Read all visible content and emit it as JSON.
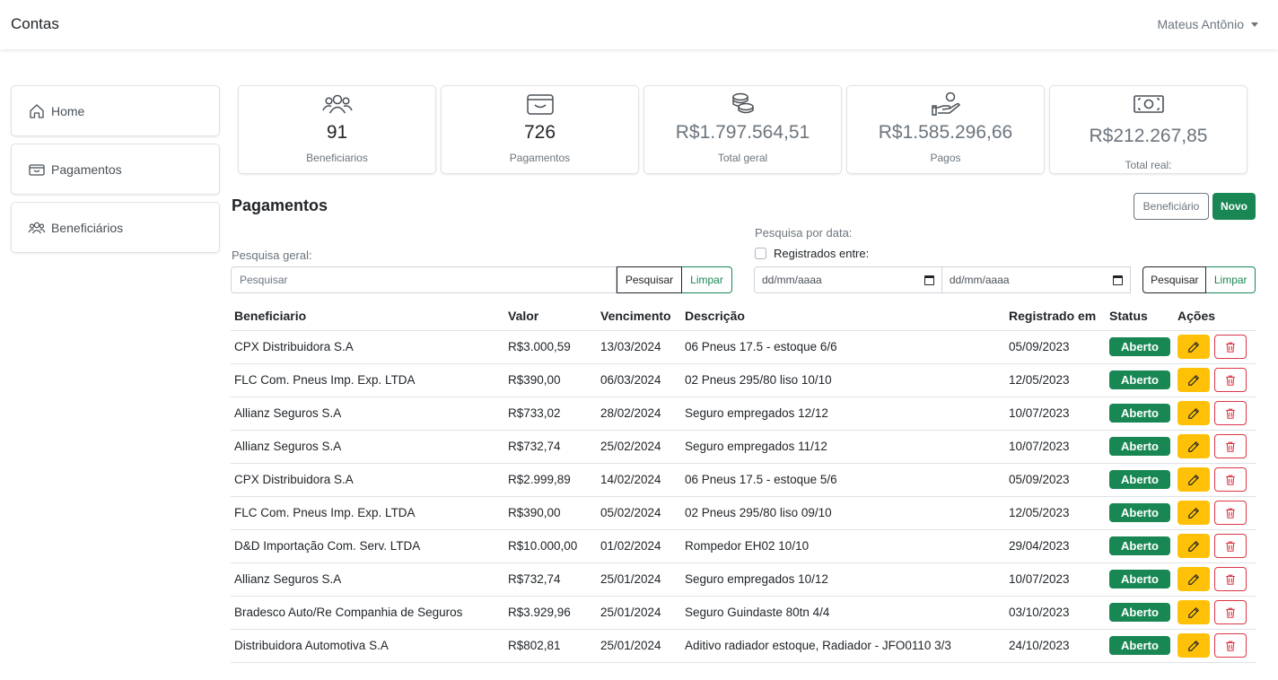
{
  "app": {
    "title": "Contas",
    "user": "Mateus Antônio"
  },
  "sidebar": {
    "items": [
      {
        "label": "Home",
        "icon": "home-icon"
      },
      {
        "label": "Pagamentos",
        "icon": "wallet-icon"
      },
      {
        "label": "Beneficiários",
        "icon": "people-icon"
      }
    ]
  },
  "cards": [
    {
      "value": "91",
      "label": "Beneficiarios",
      "icon": "people-icon"
    },
    {
      "value": "726",
      "label": "Pagamentos",
      "icon": "wallet-icon"
    },
    {
      "value": "R$1.797.564,51",
      "label": "Total geral",
      "icon": "coins-icon"
    },
    {
      "value": "R$1.585.296,66",
      "label": "Pagos",
      "icon": "hand-coin-icon"
    },
    {
      "value": "R$212.267,85",
      "label": "Total real:",
      "icon": "cash-icon"
    }
  ],
  "section": {
    "title": "Pagamentos",
    "btn_beneficiario": "Beneficiário",
    "btn_novo": "Novo"
  },
  "search_general": {
    "label": "Pesquisa geral:",
    "placeholder": "Pesquisar",
    "btn_search": "Pesquisar",
    "btn_clear": "Limpar"
  },
  "search_date": {
    "label": "Pesquisa por data:",
    "checkbox_label": "Registrados entre:",
    "date_from": "dd/mm/aaaa",
    "date_to": "dd/mm/aaaa",
    "btn_search": "Pesquisar",
    "btn_clear": "Limpar"
  },
  "table": {
    "headers": [
      "Beneficiario",
      "Valor",
      "Vencimento",
      "Descrição",
      "Registrado em",
      "Status",
      "Ações"
    ],
    "rows": [
      [
        "CPX Distribuidora S.A",
        "R$3.000,59",
        "13/03/2024",
        "06 Pneus 17.5 - estoque 6/6",
        "05/09/2023",
        "Aberto"
      ],
      [
        "FLC Com. Pneus Imp. Exp. LTDA",
        "R$390,00",
        "06/03/2024",
        "02 Pneus 295/80 liso 10/10",
        "12/05/2023",
        "Aberto"
      ],
      [
        "Allianz Seguros S.A",
        "R$733,02",
        "28/02/2024",
        "Seguro empregados 12/12",
        "10/07/2023",
        "Aberto"
      ],
      [
        "Allianz Seguros S.A",
        "R$732,74",
        "25/02/2024",
        "Seguro empregados 11/12",
        "10/07/2023",
        "Aberto"
      ],
      [
        "CPX Distribuidora S.A",
        "R$2.999,89",
        "14/02/2024",
        "06 Pneus 17.5 - estoque 5/6",
        "05/09/2023",
        "Aberto"
      ],
      [
        "FLC Com. Pneus Imp. Exp. LTDA",
        "R$390,00",
        "05/02/2024",
        "02 Pneus 295/80 liso 09/10",
        "12/05/2023",
        "Aberto"
      ],
      [
        "D&D Importação Com. Serv. LTDA",
        "R$10.000,00",
        "01/02/2024",
        "Rompedor EH02 10/10",
        "29/04/2023",
        "Aberto"
      ],
      [
        "Allianz Seguros S.A",
        "R$732,74",
        "25/01/2024",
        "Seguro empregados 10/12",
        "10/07/2023",
        "Aberto"
      ],
      [
        "Bradesco Auto/Re Companhia de Seguros",
        "R$3.929,96",
        "25/01/2024",
        "Seguro Guindaste 80tn 4/4",
        "03/10/2023",
        "Aberto"
      ],
      [
        "Distribuidora Automotiva S.A",
        "R$802,81",
        "25/01/2024",
        "Aditivo radiador estoque, Radiador - JFO0110 3/3",
        "24/10/2023",
        "Aberto"
      ]
    ]
  },
  "colors": {
    "success": "#198754",
    "warning": "#ffc107",
    "danger": "#dc3545",
    "muted": "#6c757d"
  }
}
